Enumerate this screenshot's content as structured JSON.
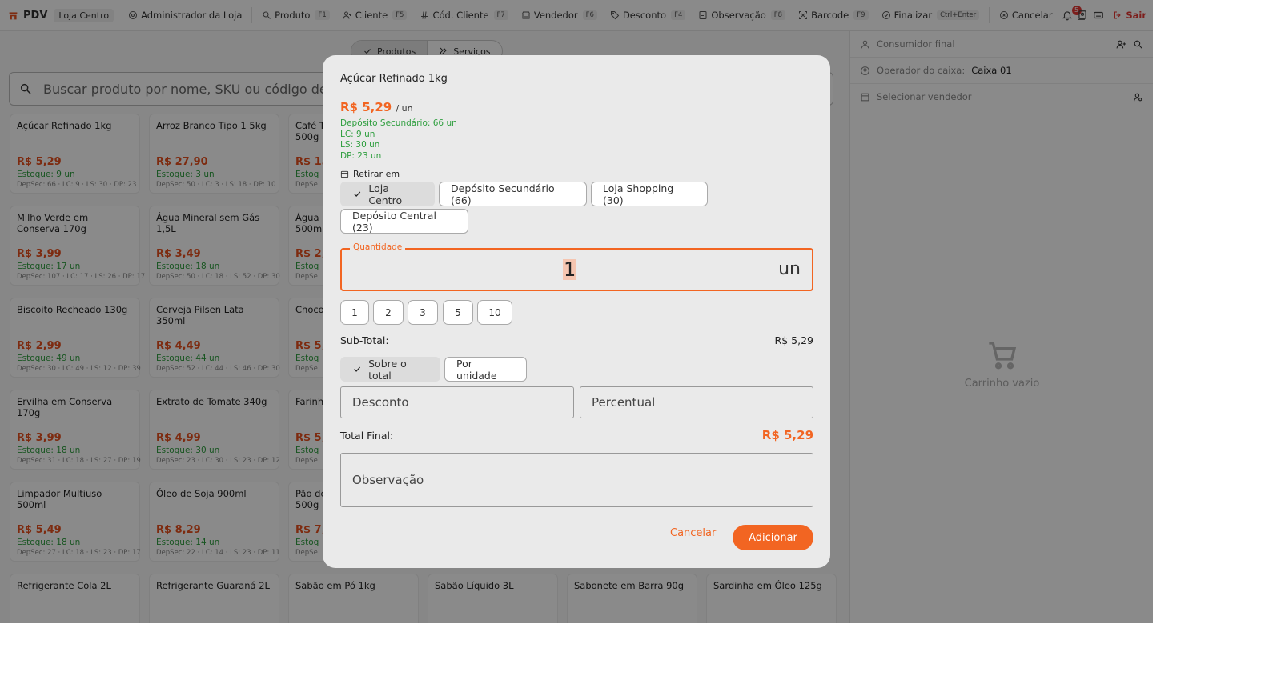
{
  "topbar": {
    "app_name": "PDV",
    "store_chip": "Loja Centro",
    "admin": "Administrador da Loja",
    "items": [
      {
        "label": "Produto",
        "key": "F1",
        "icon": "search-icon"
      },
      {
        "label": "Cliente",
        "key": "F5",
        "icon": "user-plus-icon"
      },
      {
        "label": "Cód. Cliente",
        "key": "F7",
        "icon": "hash-icon"
      },
      {
        "label": "Vendedor",
        "key": "F6",
        "icon": "store-icon"
      },
      {
        "label": "Desconto",
        "key": "F4",
        "icon": "tag-icon"
      },
      {
        "label": "Observação",
        "key": "F8",
        "icon": "note-icon"
      },
      {
        "label": "Barcode",
        "key": "F9",
        "icon": "barcode-icon"
      },
      {
        "label": "Finalizar",
        "key": "Ctrl+Enter",
        "icon": "check-circle-icon"
      }
    ],
    "cancel": "Cancelar",
    "notifications": "5",
    "exit": "Sair"
  },
  "tabs": [
    "Produtos",
    "Serviços"
  ],
  "search": {
    "placeholder": "Buscar produto por nome, SKU ou código de barras"
  },
  "products": [
    {
      "name": "Açúcar Refinado 1kg",
      "price": "R$ 5,29",
      "stock": "Estoque: 9 un",
      "dep": "DepSec: 66 · LC: 9 · LS: 30 · DP: 23"
    },
    {
      "name": "Arroz Branco Tipo 1 5kg",
      "price": "R$ 27,90",
      "stock": "Estoque: 3 un",
      "dep": "DepSec: 50 · LC: 3 · LS: 18 · DP: 10"
    },
    {
      "name": "Café T\n500g",
      "price": "R$ 15",
      "stock": "Estoq",
      "dep": "DepSe"
    },
    {
      "name": "Milho Verde em Conserva 170g",
      "price": "R$ 3,99",
      "stock": "Estoque: 17 un",
      "dep": "DepSec: 107 · LC: 17 · LS: 26 · DP: 17"
    },
    {
      "name": "Água Mineral sem Gás 1,5L",
      "price": "R$ 3,49",
      "stock": "Estoque: 18 un",
      "dep": "DepSec: 50 · LC: 18 · LS: 52 · DP: 30"
    },
    {
      "name": "Água M\n500ml",
      "price": "R$ 2,",
      "stock": "Estoq",
      "dep": "DepSe"
    },
    {
      "name": "Biscoito Recheado 130g",
      "price": "R$ 2,99",
      "stock": "Estoque: 49 un",
      "dep": "DepSec: 30 · LC: 49 · LS: 12 · DP: 39"
    },
    {
      "name": "Cerveja Pilsen Lata 350ml",
      "price": "R$ 4,49",
      "stock": "Estoque: 44 un",
      "dep": "DepSec: 52 · LC: 44 · LS: 46 · DP: 30"
    },
    {
      "name": "Choco",
      "price": "R$ 5,",
      "stock": "Estoq",
      "dep": "DepSe"
    },
    {
      "name": "Ervilha em Conserva 170g",
      "price": "R$ 3,99",
      "stock": "Estoque: 18 un",
      "dep": "DepSec: 31 · LC: 18 · LS: 27 · DP: 19"
    },
    {
      "name": "Extrato de Tomate 340g",
      "price": "R$ 4,99",
      "stock": "Estoque: 30 un",
      "dep": "DepSec: 23 · LC: 30 · LS: 23 · DP: 12"
    },
    {
      "name": "Farinh",
      "price": "R$ 5,",
      "stock": "Estoq",
      "dep": "DepSe"
    },
    {
      "name": "Limpador Multiuso 500ml",
      "price": "R$ 5,49",
      "stock": "Estoque: 18 un",
      "dep": "DepSec: 27 · LC: 18 · LS: 23 · DP: 17"
    },
    {
      "name": "Óleo de Soja 900ml",
      "price": "R$ 8,29",
      "stock": "Estoque: 14 un",
      "dep": "DepSec: 22 · LC: 14 · LS: 23 · DP: 11"
    },
    {
      "name": "Pão de\n500g",
      "price": "R$ 7,",
      "stock": "Estoq",
      "dep": "DepSe"
    },
    {
      "name": "Refrigerante Cola 2L",
      "price": "",
      "stock": "",
      "dep": ""
    },
    {
      "name": "Refrigerante Guaraná 2L",
      "price": "",
      "stock": "",
      "dep": ""
    },
    {
      "name": "Sabão em Pó 1kg",
      "price": "",
      "stock": "",
      "dep": ""
    },
    {
      "name": "Sabão Líquido 3L",
      "price": "",
      "stock": "",
      "dep": ""
    },
    {
      "name": "Sabonete em Barra 90g",
      "price": "",
      "stock": "",
      "dep": ""
    },
    {
      "name": "Sardinha em Óleo 125g",
      "price": "",
      "stock": "",
      "dep": ""
    }
  ],
  "right_panel": {
    "customer": "Consumidor final",
    "operator_label": "Operador do caixa:",
    "operator_value": "Caixa 01",
    "seller": "Selecionar vendedor",
    "empty_cart": "Carrinho vazio"
  },
  "modal": {
    "title": "Açúcar Refinado 1kg",
    "price": "R$ 5,29",
    "unit_suffix": "/ un",
    "stock_lines": [
      "Depósito Secundário: 66 un",
      "LC: 9 un",
      "LS: 30 un",
      "DP: 23 un"
    ],
    "retirar_label": "Retirar em",
    "locations": [
      {
        "label": "Loja Centro",
        "selected": true
      },
      {
        "label": "Depósito Secundário (66)",
        "selected": false
      },
      {
        "label": "Loja Shopping (30)",
        "selected": false
      },
      {
        "label": "Depósito Central (23)",
        "selected": false
      }
    ],
    "quantity_label": "Quantidade",
    "quantity_value": "1",
    "quantity_unit": "un",
    "quick_qty": [
      "1",
      "2",
      "3",
      "5",
      "10"
    ],
    "subtotal_label": "Sub-Total:",
    "subtotal_value": "R$ 5,29",
    "discount_modes": [
      {
        "label": "Sobre o total",
        "selected": true
      },
      {
        "label": "Por unidade",
        "selected": false
      }
    ],
    "discount_placeholder": "Desconto",
    "percent_placeholder": "Percentual",
    "total_label": "Total Final:",
    "total_value": "R$ 5,29",
    "obs_placeholder": "Observação",
    "cancel": "Cancelar",
    "add": "Adicionar",
    "accent": "#f26522"
  }
}
